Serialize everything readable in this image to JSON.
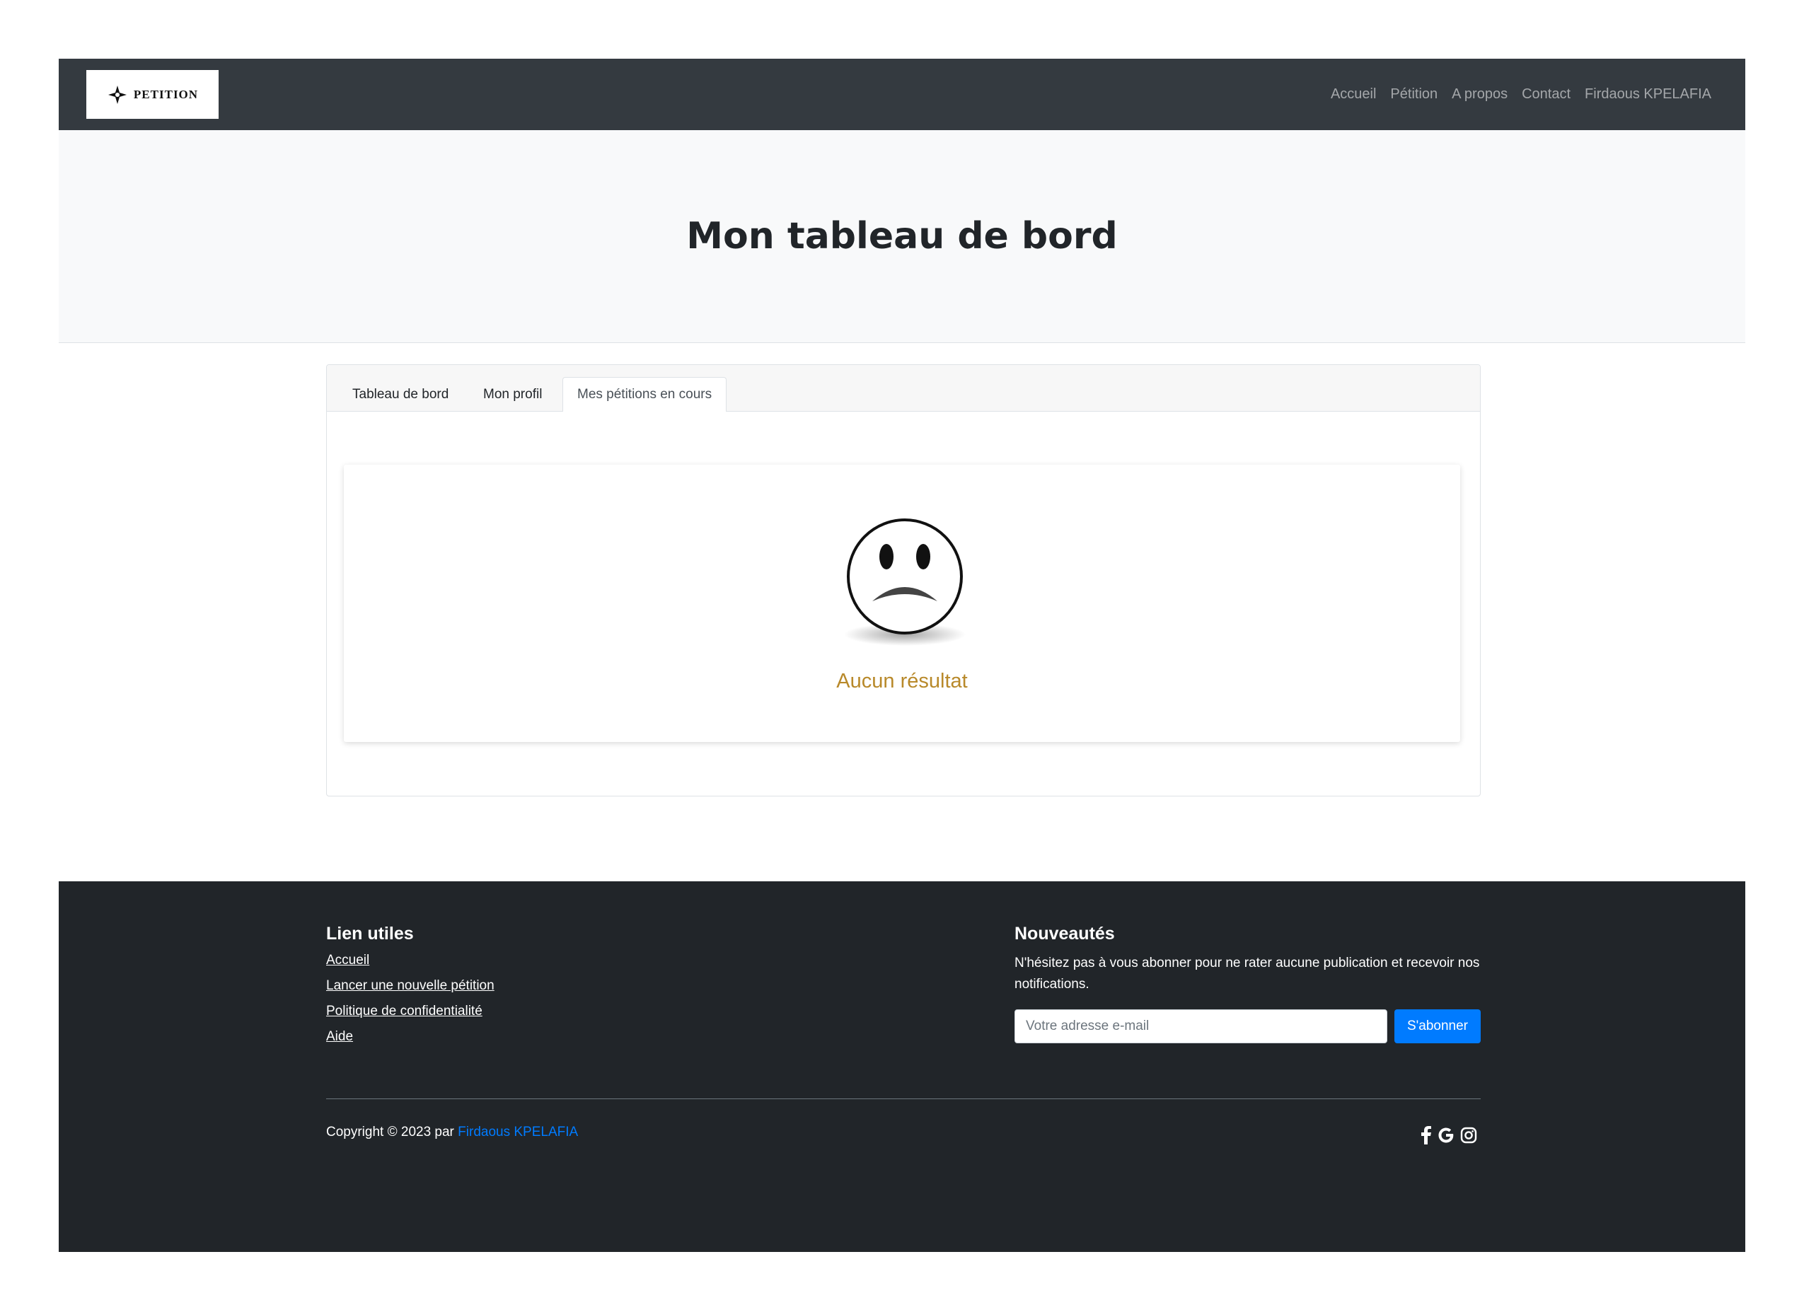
{
  "navbar": {
    "brand": "PETITION",
    "links": [
      "Accueil",
      "Pétition",
      "A propos",
      "Contact",
      "Firdaous KPELAFIA"
    ]
  },
  "hero": {
    "title": "Mon tableau de bord"
  },
  "tabs": [
    {
      "label": "Tableau de bord",
      "active": false
    },
    {
      "label": "Mon profil",
      "active": false
    },
    {
      "label": "Mes pétitions en cours",
      "active": true
    }
  ],
  "empty_state": {
    "message": "Aucun résultat",
    "icon": "sad-face-icon",
    "color": "#b8892a"
  },
  "footer": {
    "useful_links": {
      "heading": "Lien utiles",
      "items": [
        "Accueil",
        "Lancer une nouvelle pétition",
        "Politique de confidentialité",
        "Aide"
      ]
    },
    "news": {
      "heading": "Nouveautés",
      "text": "N'hésitez pas à vous abonner pour ne rater aucune publication et recevoir nos notifications.",
      "input_placeholder": "Votre adresse e-mail",
      "button_label": "S'abonner"
    },
    "copyright_prefix": "Copyright © 2023 par ",
    "copyright_author": "Firdaous KPELAFIA",
    "social_icons": [
      "facebook-icon",
      "google-icon",
      "instagram-icon"
    ]
  },
  "colors": {
    "navbar_bg": "#343a40",
    "footer_bg": "#212529",
    "accent": "#007bff"
  }
}
